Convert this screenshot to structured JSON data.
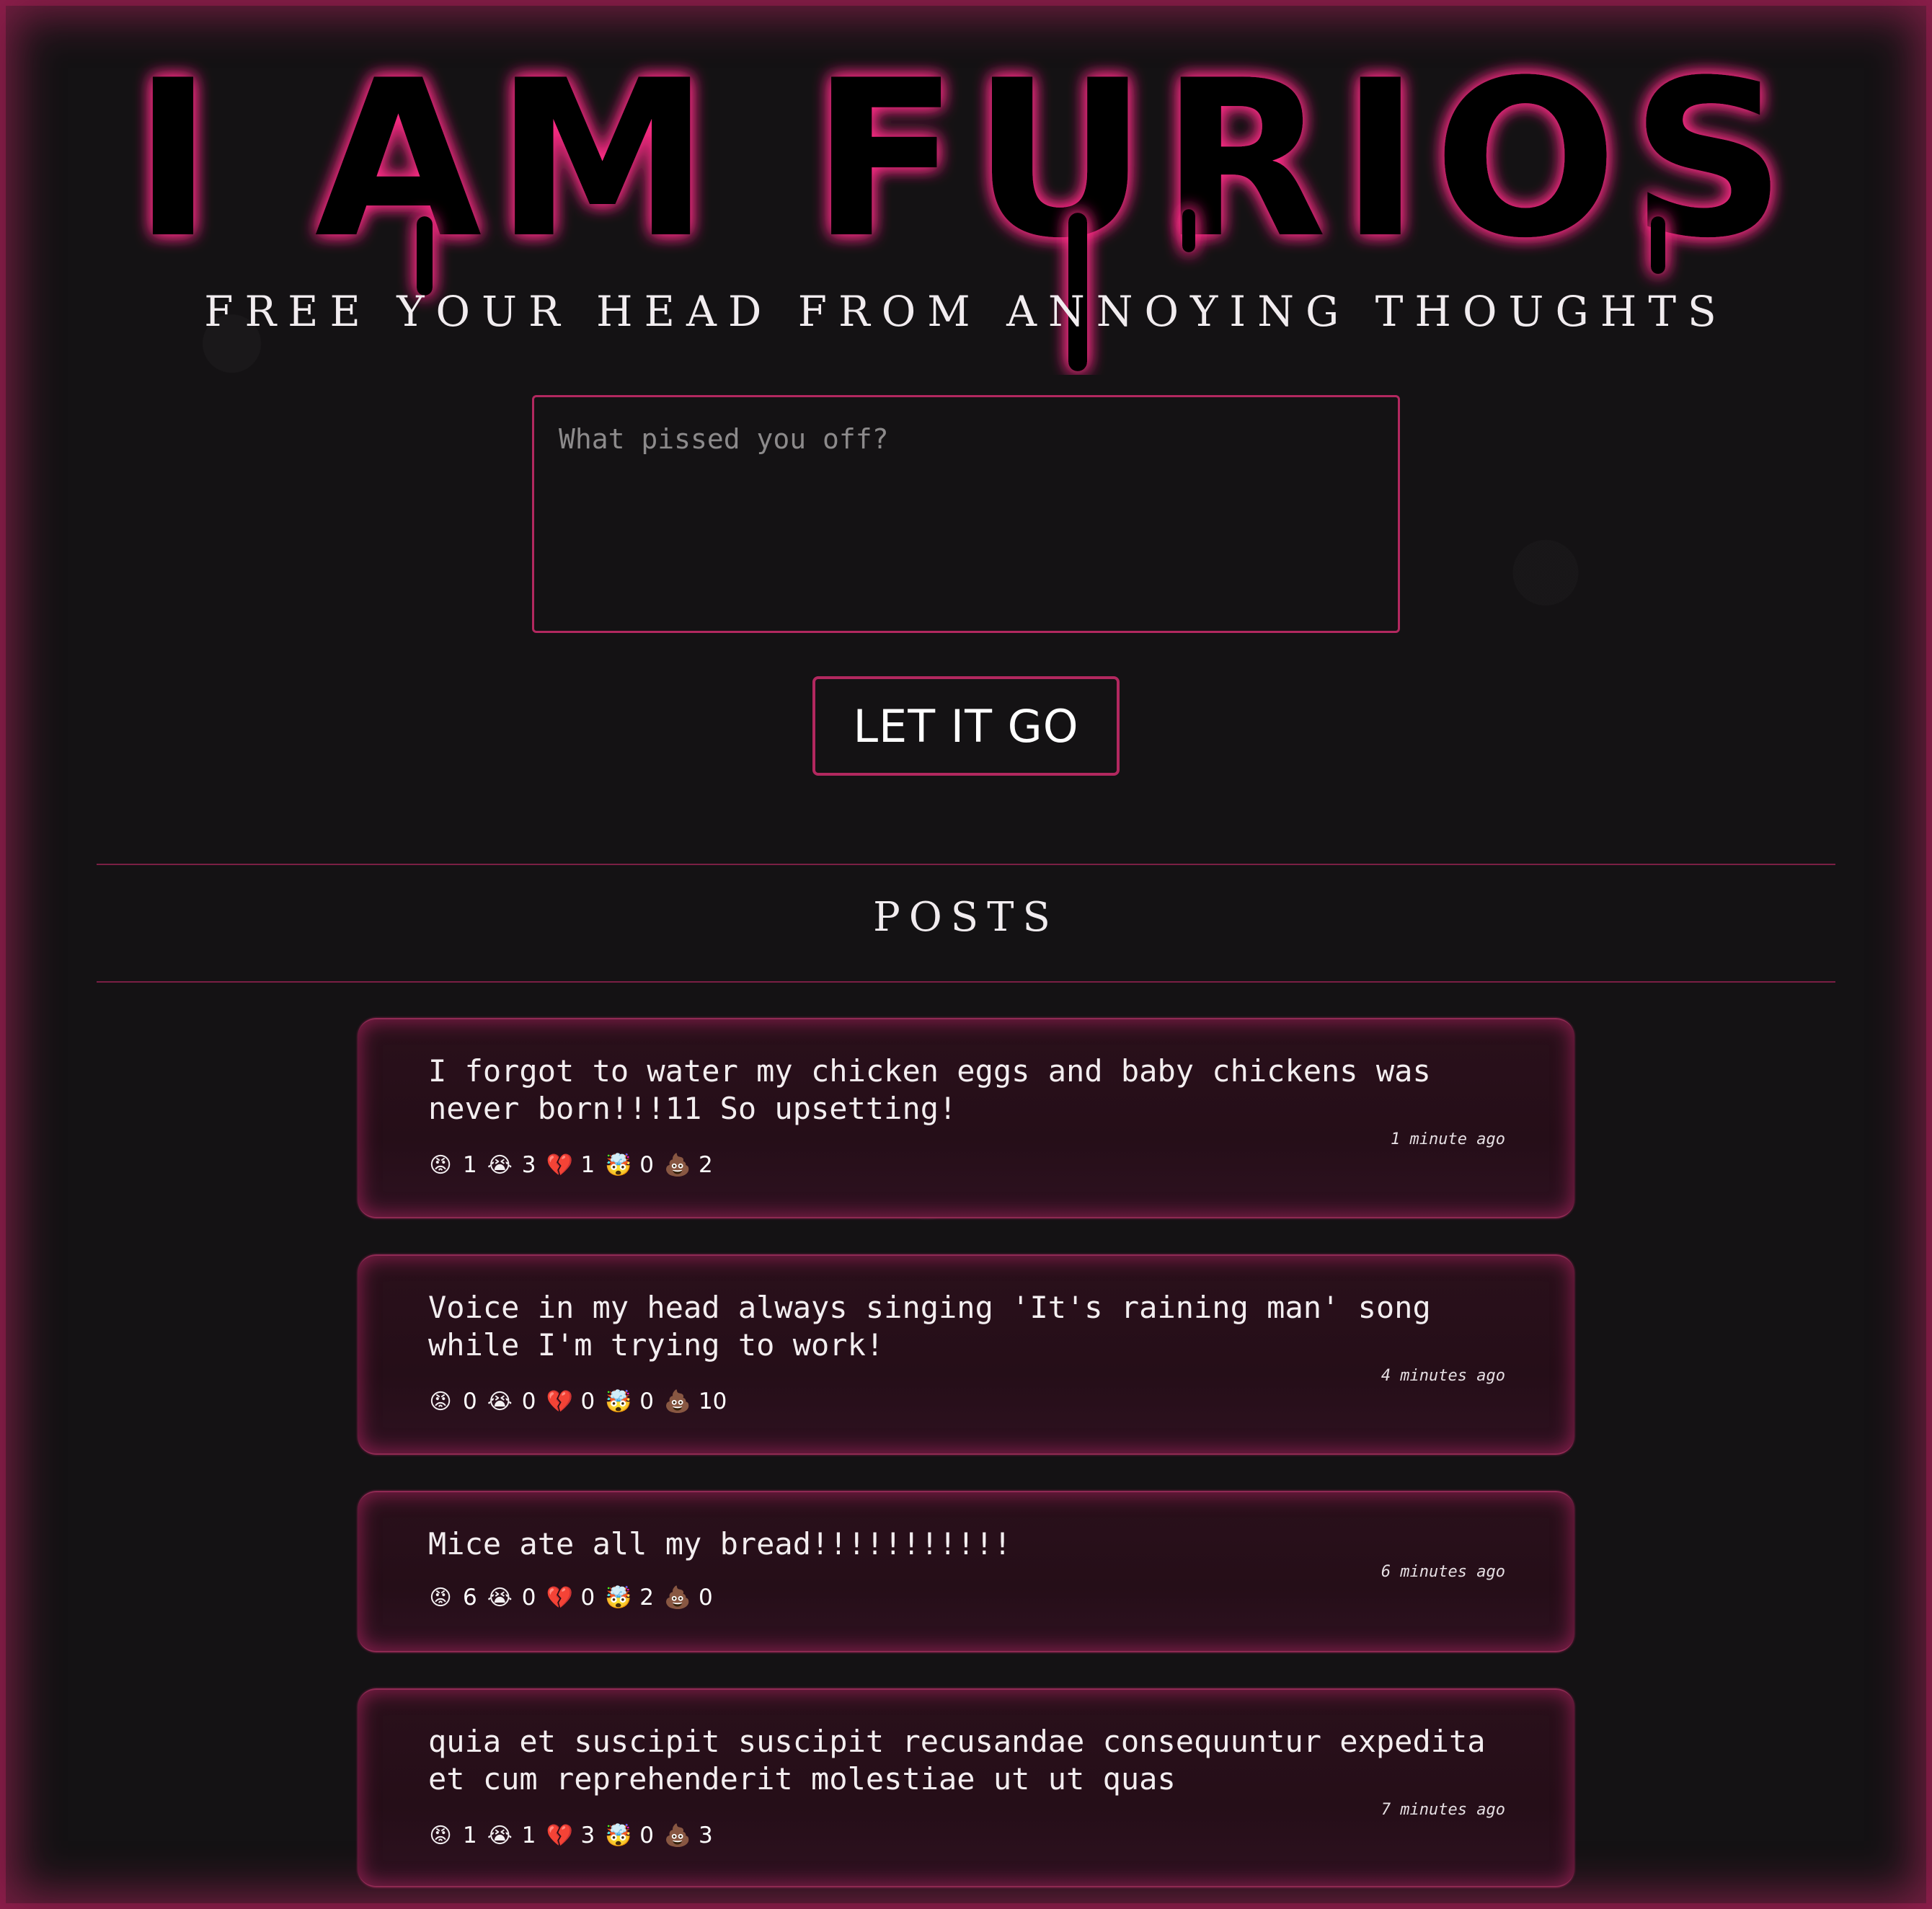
{
  "header": {
    "logo_text": "I AM FURIOS",
    "tagline": "FREE YOUR HEAD FROM ANNOYING THOUGHTS"
  },
  "compose": {
    "placeholder": "What pissed you off?",
    "value": "",
    "submit_label": "LET IT GO"
  },
  "posts_section": {
    "heading": "POSTS"
  },
  "reaction_icons": [
    "angry-face-icon",
    "crying-face-icon",
    "broken-heart-icon",
    "exploding-head-icon",
    "poop-icon"
  ],
  "reaction_glyphs": [
    "😡",
    "😭",
    "💔",
    "🤯",
    "💩"
  ],
  "colors": {
    "accent": "#b2285f",
    "background": "#141214",
    "post_bg": "#2a101b"
  },
  "posts": [
    {
      "text": "I forgot to water my chicken eggs and baby chickens was never born!!!11 So upsetting!",
      "time": "1 minute ago",
      "reactions": [
        "1",
        "3",
        "1",
        "0",
        "2"
      ]
    },
    {
      "text": "Voice in my head always singing 'It's raining man' song while I'm trying to work!",
      "time": "4 minutes ago",
      "reactions": [
        "0",
        "0",
        "0",
        "0",
        "10"
      ]
    },
    {
      "text": "Mice ate all my bread!!!!!!!!!!!",
      "time": "6 minutes ago",
      "reactions": [
        "6",
        "0",
        "0",
        "2",
        "0"
      ]
    },
    {
      "text": "quia et suscipit suscipit recusandae consequuntur expedita et cum reprehenderit molestiae ut ut quas",
      "time": "7 minutes ago",
      "reactions": [
        "1",
        "1",
        "3",
        "0",
        "3"
      ]
    }
  ]
}
